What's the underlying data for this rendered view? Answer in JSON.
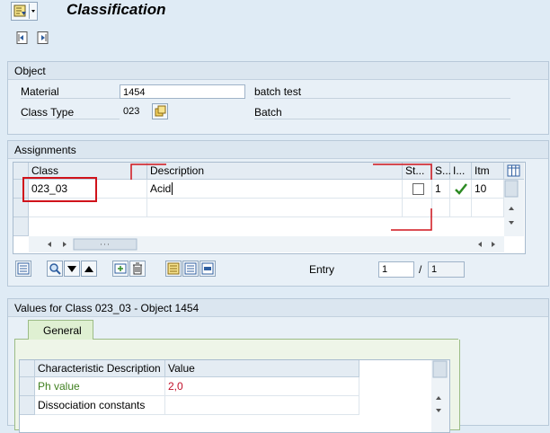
{
  "window": {
    "title": "Classification"
  },
  "object_group": {
    "header": "Object",
    "material_label": "Material",
    "material_value": "1454",
    "material_desc": "batch test",
    "class_type_label": "Class Type",
    "class_type_value": "023",
    "class_type_desc": "Batch"
  },
  "assignments": {
    "header": "Assignments",
    "columns": {
      "class": "Class",
      "description": "Description",
      "status": "St...",
      "s": "S...",
      "i": "I...",
      "itm": "Itm"
    },
    "rows": [
      {
        "class": "023_03",
        "description": "Acid",
        "s": "1",
        "itm": "10"
      }
    ],
    "entry_label": "Entry",
    "entry_value": "1",
    "entry_sep": "/",
    "entry_total": "1"
  },
  "values_group": {
    "header": "Values for Class 023_03 - Object 1454",
    "tab_general": "General",
    "columns": {
      "char_desc": "Characteristic Description",
      "value": "Value"
    },
    "rows": [
      {
        "char_desc": "Ph value",
        "value": "2,0"
      },
      {
        "char_desc": "Dissociation constants",
        "value": ""
      }
    ]
  },
  "colors": {
    "background": "#dfebf5",
    "highlight_red": "#d0131b",
    "ph_value_text": "#3f7f1f",
    "value_text": "#c0102a",
    "check_green": "#2d8a23"
  }
}
